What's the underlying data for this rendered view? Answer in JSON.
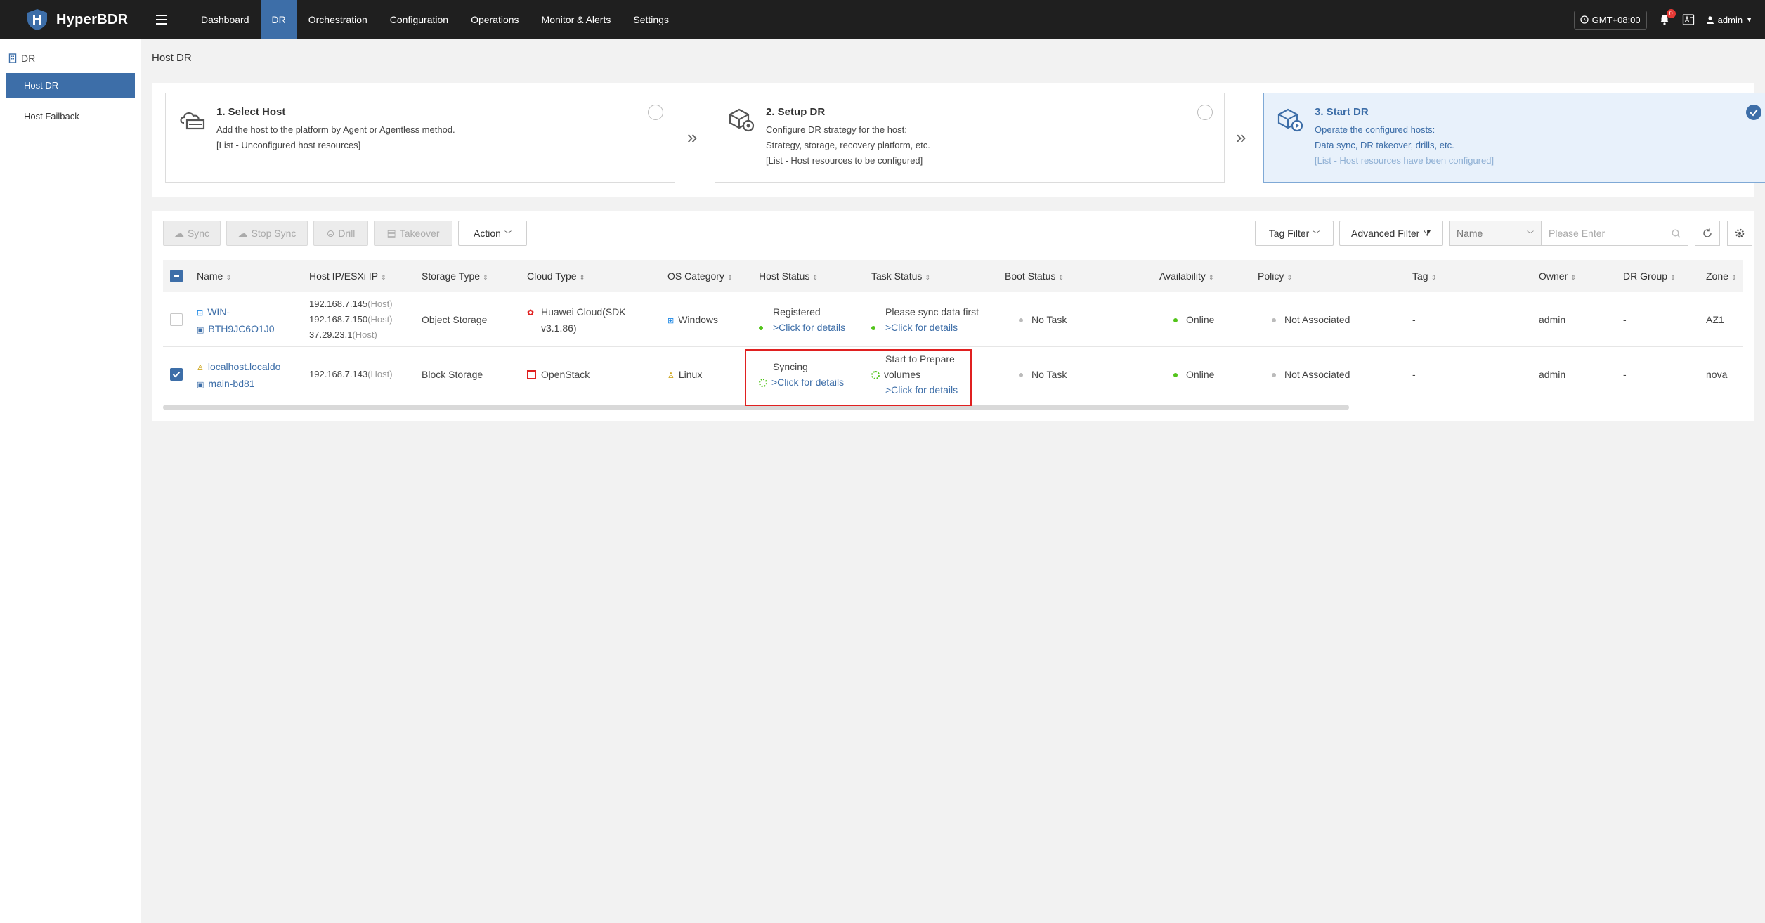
{
  "app": {
    "name": "HyperBDR"
  },
  "nav": {
    "items": [
      {
        "label": "Dashboard",
        "active": false
      },
      {
        "label": "DR",
        "active": true
      },
      {
        "label": "Orchestration",
        "active": false
      },
      {
        "label": "Configuration",
        "active": false
      },
      {
        "label": "Operations",
        "active": false
      },
      {
        "label": "Monitor & Alerts",
        "active": false
      },
      {
        "label": "Settings",
        "active": false
      }
    ]
  },
  "header": {
    "timezone": "GMT+08:00",
    "notifications": "0",
    "user": "admin"
  },
  "sidebar": {
    "group": "DR",
    "items": [
      {
        "label": "Host DR",
        "active": true
      },
      {
        "label": "Host Failback",
        "active": false
      }
    ]
  },
  "page": {
    "title": "Host DR"
  },
  "steps": [
    {
      "title": "1. Select Host",
      "lines": [
        "Add the host to the platform by Agent or Agentless method.",
        "[List - Unconfigured host resources]"
      ]
    },
    {
      "title": "2. Setup DR",
      "lines": [
        "Configure DR strategy for the host:",
        "Strategy, storage, recovery platform, etc.",
        "[List - Host resources to be configured]"
      ]
    },
    {
      "title": "3. Start DR",
      "lines": [
        "Operate the configured hosts:",
        "Data sync, DR takeover, drills, etc.",
        "[List - Host resources have been configured]"
      ]
    }
  ],
  "toolbar": {
    "sync": "Sync",
    "stop_sync": "Stop Sync",
    "drill": "Drill",
    "takeover": "Takeover",
    "action": "Action",
    "tag_filter": "Tag Filter",
    "advanced_filter": "Advanced Filter",
    "filter_field": "Name",
    "search_placeholder": "Please Enter"
  },
  "table": {
    "columns": [
      "Name",
      "Host IP/ESXi IP",
      "Storage Type",
      "Cloud Type",
      "OS Category",
      "Host Status",
      "Task Status",
      "Boot Status",
      "Availability",
      "Policy",
      "Tag",
      "Owner",
      "DR Group",
      "Zone"
    ],
    "rows": [
      {
        "checked": false,
        "name_line1": "WIN-",
        "name_line2": "BTH9JC6O1J0",
        "ips": [
          {
            "ip": "192.168.7.145",
            "type": "(Host)"
          },
          {
            "ip": "192.168.7.150",
            "type": "(Host)"
          },
          {
            "ip": "37.29.23.1",
            "type": "(Host)"
          }
        ],
        "storage": "Object Storage",
        "cloud_line1": "Huawei Cloud(SDK",
        "cloud_line2": "v3.1.86)",
        "os": "Windows",
        "host_status": "Registered",
        "host_status_link": ">Click for details",
        "task_status_line1": "Please sync data first",
        "task_status_line2": "",
        "task_status_link": ">Click for details",
        "boot_status": "No Task",
        "availability": "Online",
        "policy": "Not Associated",
        "tag": "-",
        "owner": "admin",
        "dr_group": "-",
        "zone": "AZ1"
      },
      {
        "checked": true,
        "name_line1": "localhost.localdo",
        "name_line2": "main-bd81",
        "ips": [
          {
            "ip": "192.168.7.143",
            "type": "(Host)"
          }
        ],
        "storage": "Block Storage",
        "cloud_line1": "OpenStack",
        "cloud_line2": "",
        "os": "Linux",
        "host_status": "Syncing",
        "host_status_link": ">Click for details",
        "task_status_line1": "Start to Prepare",
        "task_status_line2": "volumes",
        "task_status_link": ">Click for details",
        "boot_status": "No Task",
        "availability": "Online",
        "policy": "Not Associated",
        "tag": "-",
        "owner": "admin",
        "dr_group": "-",
        "zone": "nova"
      }
    ]
  },
  "colors": {
    "accent": "#3d6ea8",
    "topbar": "#1f1f1f",
    "online": "#52c41a",
    "highlight": "#e02020"
  }
}
